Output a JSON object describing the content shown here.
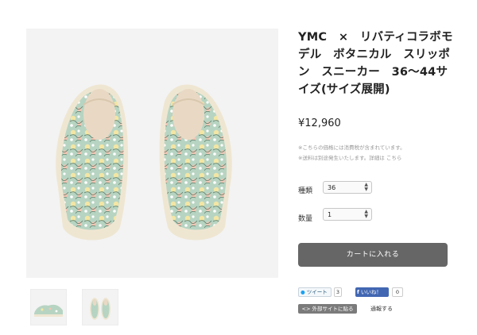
{
  "product": {
    "title": "YMC　×　リバティコラボモデル　ボタニカル　スリッポン　スニーカー　36〜44サイズ(サイズ展開)",
    "price": "¥12,960",
    "tax_note": "※こちらの価格には消費税が含まれています。",
    "shipping_note": "※送料は別途発生いたします。詳細は",
    "shipping_link": "こちら",
    "colors": {
      "button": "#666666",
      "shoe_pattern": "#a8c9b4",
      "sole": "#efe6d2"
    }
  },
  "options": [
    {
      "label": "種類",
      "value": "36"
    },
    {
      "label": "数量",
      "value": "1"
    }
  ],
  "cart_button": "カートに入れる",
  "share": {
    "tweet_label": "ツイート",
    "tweet_count": "3",
    "like_label": "いいね！",
    "like_count": "0",
    "embed_label": "<> 外部サイトに貼る",
    "report_label": "通報する"
  },
  "icons": [
    "twitter-bird-icon",
    "facebook-f-icon",
    "select-arrows-icon"
  ]
}
